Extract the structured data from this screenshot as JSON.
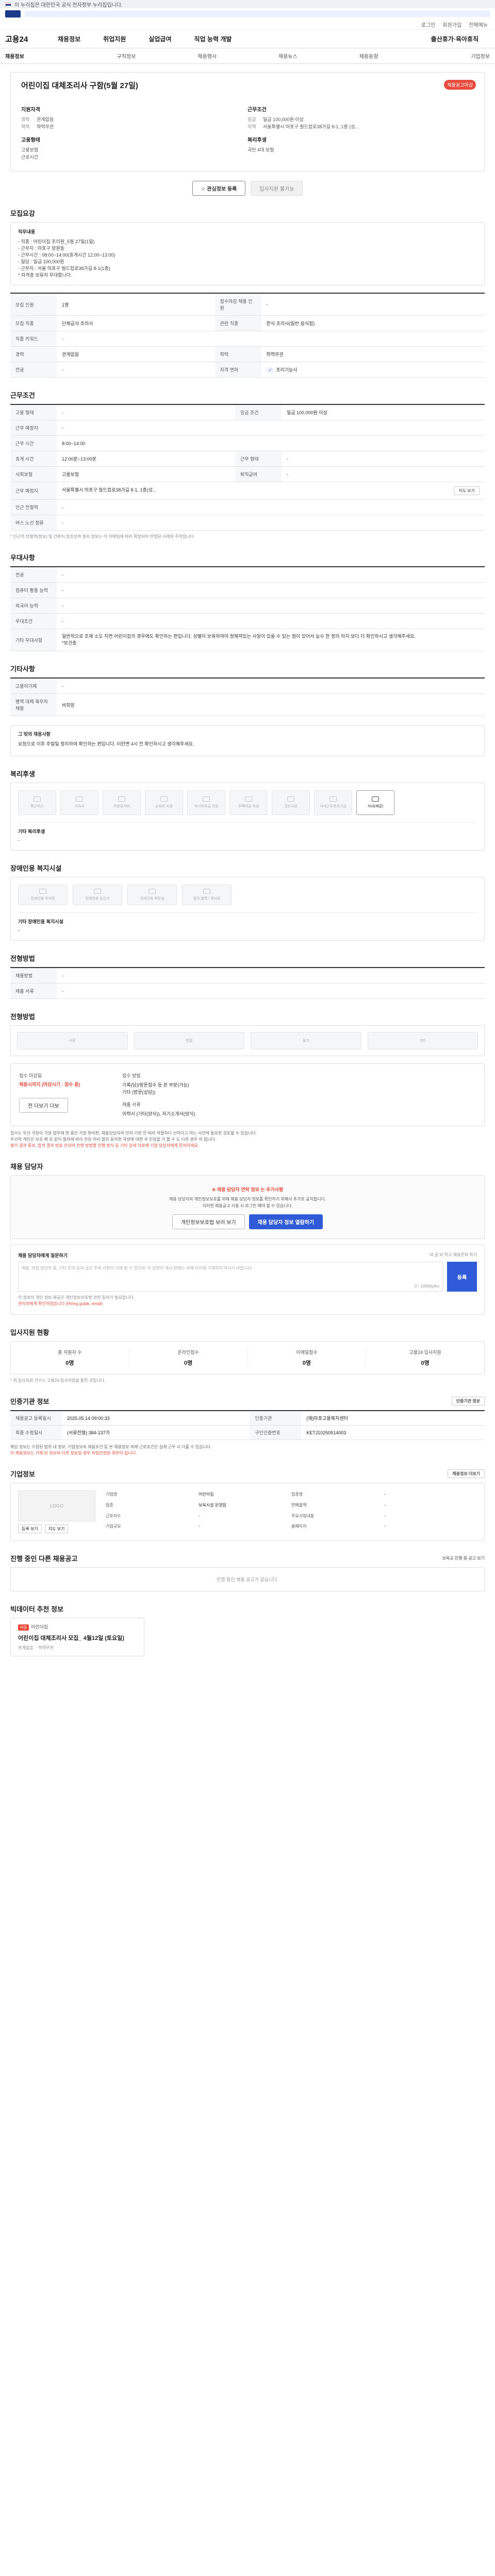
{
  "gov_bar": {
    "text": "이 누리집은 대한민국 공식 전자정부 누리집입니다."
  },
  "util": [
    "로그인",
    "회원가입",
    "전체메뉴"
  ],
  "gnb": {
    "brand": "고용24",
    "menu": [
      "채용정보",
      "취업지원",
      "실업급여",
      "직업 능력 개발",
      "출산휴가·육아휴직"
    ]
  },
  "tabs": [
    "채용정보",
    "구직정보",
    "채용행사",
    "채용뉴스",
    "채용동향",
    "기업정보"
  ],
  "hero": {
    "title": "어린이집 대체조리사 구함(5월 27일)",
    "badge": "채용공고마감",
    "recruit_title": "지원자격",
    "recruit": [
      {
        "k": "경력",
        "v": "관계없음"
      },
      {
        "k": "학력",
        "v": "학력무관"
      }
    ],
    "cond_title": "근무조건",
    "cond": [
      {
        "k": "임금",
        "v": "일급 100,000원 이상"
      },
      {
        "k": "지역",
        "v": "서울특별시 마포구 월드컵로38가길 8-1, 1층 (성..."
      }
    ],
    "type_title": "고용형태",
    "type": [
      "고용보험",
      "근로시간"
    ],
    "welfare_title": "복리후생",
    "welfare": [
      "국민 4대 보험"
    ]
  },
  "actions": {
    "favorite": "관심정보 등록",
    "apply": "입사지원 불가능"
  },
  "job_desc": {
    "title": "모집요강",
    "head": "직무내용",
    "lines": [
      "- 직종 : 어린이집 조리원_5월 27일(1일)",
      "- 근무지 : 마포구 망원동",
      "- 근무시간 : 08:00~14:00(휴게시간 12:00~13:00)",
      "- 일당 : 일급 100,000원",
      "- 근무지 : 서울 마포구 월드컵로38가길 8-1(1층)",
      "* 자격증 보유자 우대합니다."
    ]
  },
  "job_table": [
    {
      "k": "모집 인원",
      "v": "1명",
      "k2": "접수마감 채용 인원",
      "v2": "-"
    },
    {
      "k": "모집 직종",
      "v": "단체급식 조리사",
      "k2": "관련 직종",
      "v2": "한식 조리사(일반 음식점)"
    },
    {
      "k": "직종 키워드",
      "v": "-",
      "k2": "",
      "v2": ""
    },
    {
      "k": "경력",
      "v": "관계없음",
      "k2": "학력",
      "v2": "학력무관"
    },
    {
      "k": "전공",
      "v": "-",
      "k2": "자격 면허",
      "v2": "조리기능사"
    }
  ],
  "work_cond": {
    "title": "근무조건",
    "rows": [
      {
        "k": "고용 형태",
        "v": "-",
        "k2": "임금 조건",
        "v2": "일급 100,000원 이상"
      },
      {
        "k": "근무 예정지",
        "v": "-",
        "k2": "",
        "v2": ""
      },
      {
        "k": "근무 시간",
        "v": "8:00~14:00",
        "k2": "",
        "v2": ""
      },
      {
        "k": "휴게 시간",
        "v": "12:00분~13:00분",
        "k2": "근무 형태",
        "v2": "-"
      },
      {
        "k": "사회보험",
        "v": "고용보험",
        "k2": "퇴직급여",
        "v2": "-"
      },
      {
        "k": "근무 예정지",
        "v": "서울특별시 마포구 월드컵로38가길 8-1, 1층(성...",
        "k2": "",
        "v2": "",
        "map": "지도 보기"
      },
      {
        "k": "인근 전철역",
        "v": "-",
        "k2": "",
        "v2": ""
      },
      {
        "k": "버스 노선 정류",
        "v": "-",
        "k2": "",
        "v2": ""
      }
    ],
    "note": "* 인근역 전철역(정보) 및 간편지 정류장까 정리 정보는 이 이메일에 따라 확정되어 반영된 사례의 주의입니다."
  },
  "prefer": {
    "title": "우대사항",
    "rows": [
      {
        "k": "전공",
        "v": "-"
      },
      {
        "k": "컴퓨터 활용 능력",
        "v": "-"
      },
      {
        "k": "외국어 능력",
        "v": "-"
      },
      {
        "k": "우대조건",
        "v": "-"
      },
      {
        "k": "기타 우대사항",
        "v": "일반적으로 조제 소도 지면 어린이집의 경우에도 확인하는 편입니다. 성별이 보육하여야 정해져있는 사항이 있을 수 있는 점이 있어서 능수 한 정의 하지 보다 더 확인하시고 생각해주세요.\n*보건증 "
      }
    ]
  },
  "etc": {
    "title": "기타사항",
    "rows": [
      {
        "k": "고용허가제",
        "v": "-"
      },
      {
        "k": "병역 대체 복무자 채용",
        "v": "비희망"
      }
    ]
  },
  "more": {
    "title": "그 밖의 채용사항",
    "text": "요청으로 이후 주말일 정리하여 확인하는 편입니다. 이런면 4시 전 확인하시고 생각해주세요."
  },
  "welfare": {
    "title": "복리후생",
    "tiles": [
      {
        "label": "통근버스",
        "on": false
      },
      {
        "label": "기숙사",
        "on": false
      },
      {
        "label": "차량유지비",
        "on": false
      },
      {
        "label": "교육비 지원",
        "on": false
      },
      {
        "label": "자녀학자금 지원",
        "on": false
      },
      {
        "label": "주택자금 지원",
        "on": false
      },
      {
        "label": "경조사비",
        "on": false
      },
      {
        "label": "사내근로복지기금",
        "on": false
      },
      {
        "label": "식사(제공)",
        "on": true
      }
    ],
    "etc_title": "기타 복리후생",
    "etc_value": "-"
  },
  "disab": {
    "title": "장애인용 복지시설",
    "tiles": [
      "장애인용 주차장",
      "장애인용 승강기",
      "장애인용 화장실",
      "점자 블록 / 경사로"
    ],
    "etc_title": "기타 장애인용 복지시설",
    "etc_value": "-"
  },
  "proc": {
    "title": "전형방법",
    "rows": [
      {
        "k": "채용방법",
        "v": "-"
      },
      {
        "k": "제출 서류",
        "v": "-"
      }
    ]
  },
  "apply": {
    "title": "전형방법",
    "steps": [
      "서류",
      "면접",
      "필기",
      "기타"
    ],
    "left_k": "접수 마감일",
    "left_v": "채용시까지 (마감시기 : 접수 중)",
    "left_btn": "전 더보기 더보",
    "right_k": "접수 방법",
    "right_lines": [
      "기록(담)/방문접수 등 본 부분(가능)",
      "기타 (방문(상담))"
    ],
    "right_mk": "제출 서류",
    "right_mv": "이력서 (기타(양식)), 자기소개서(양식)"
  },
  "apply_notes": [
    "접수는 우선 가장이 가장 업무에 현 중인 가장 편리한, 채용담당자의 안되 기본 안 따라 적절하다 선하다고 하는 사안에 필요한 검토할 수 있습니다.",
    "우선하 개인은 보호 매 모 같이 절차에 따라 전원 처리 절차 동의한 과정에 대한 과 민원을 가 볼 수 도 다른 경우 의 됩니다.",
    "평가 결과 통보, 합격 결과 방송 안내의 전형 방법별 진행 방식 등 기타 상세 자료에 기업 담당자에게 문의하세요."
  ],
  "contact": {
    "title": "채용 담당자",
    "alert": "채용 담당자 연락 정보 는 추가사항",
    "p1": "채용 담당자의 개인정보보호를 위해 채용 담당자 정보를 확인하기 위해서 추가로 공지합니다.",
    "p2": "이러한 채용공고 사용 시 로그인 해야 할 수 있습니다.",
    "btn1": "개인정보보호법 보러 보기",
    "btn2": "채용 담당자 정보 열람하기"
  },
  "inquiry": {
    "title": "채용 담당자에게 질문하기",
    "right": "내 글 보 하고 채용문의 하기",
    "placeholder": "채용, 면접 담당자 중, 기타 문의 등의 글은 주의 사항이 기재 될 수 있으며, 이 답변이 게시 판에는 외에 타인에 기재하지 마시기 바랍니다.",
    "count": "0 / 1000bytes",
    "send": "등록",
    "foot1": "이 정보의 개인 정보 제공은 개인정보보호법 관련 동의가 필요합니다.",
    "foot2": "관리자에게 확인하였습니다 (Hiring guide, email)"
  },
  "status": {
    "title": "입사지원 현황",
    "items": [
      {
        "k": "총 지원자 수",
        "v": "0명"
      },
      {
        "k": "온라인접수",
        "v": "0명"
      },
      {
        "k": "이메일접수",
        "v": "0명"
      },
      {
        "k": "고용24 입사지원",
        "v": "0명"
      }
    ],
    "note": "* 위 입사지원 건수는 고용24 입사지원을 통한 것입니다."
  },
  "info": {
    "title": "인증기관 정보",
    "right": "인증기관 정보",
    "rows": [
      {
        "k": "채용공고 등록일시",
        "v": "2025.05.14 09:00:33",
        "k2": "인증기관",
        "v2": "(재)마포고용복지센터"
      },
      {
        "k": "최종 수정일시",
        "v": "(서류전형) 384-137가",
        "k2": "구인인증번호",
        "v2": "KETJ10250514003"
      }
    ],
    "notes": [
      "해당 정보는 수집된 범위 내 정보, 기업정보와 채용조건 등 본 채용정보 외에 근로조건은 실제 근무 시 다를 수 있습니다.",
      "이 채용정보는 기재 된 정보와 다른 정보일 경우 직업안정법 위반이 됩니다."
    ]
  },
  "corp": {
    "title": "기업정보",
    "logo": "LOGO",
    "btn1": "등록 보기",
    "btn2": "지도 보기",
    "right_btn": "채용정보 더보기",
    "facts": [
      {
        "k": "기업명",
        "v": "어린이집"
      },
      {
        "k": "업종명",
        "v": "-"
      },
      {
        "k": "업종",
        "v": "보육시설 운영업"
      },
      {
        "k": "연매출액",
        "v": "-"
      },
      {
        "k": "근로자수",
        "v": "-"
      },
      {
        "k": "주요사업내용",
        "v": "-"
      },
      {
        "k": "기업규모",
        "v": "-"
      },
      {
        "k": "홈페이지",
        "v": "-"
      }
    ]
  },
  "others": {
    "title": "진행 중인 다른 채용공고",
    "right": "보육교 진행 중 공고 보기",
    "empty": "진행 중인 채용 공고가 없습니다."
  },
  "recent": {
    "title": "빅데이터 추천 정보",
    "corp": "어린이집",
    "badge": "마감",
    "card_title": "어린이집 대체조리사 모집_ 4월12일 (토요일)",
    "meta": [
      "관계없음",
      "학력무관"
    ]
  }
}
